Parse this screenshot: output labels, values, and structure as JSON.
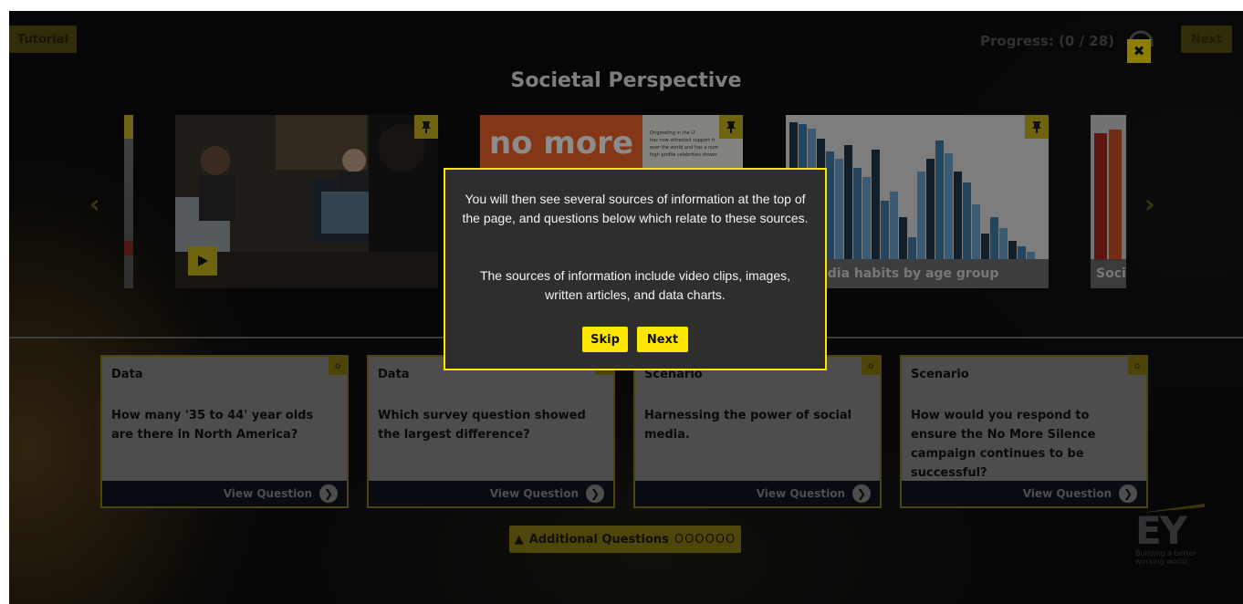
{
  "header": {
    "tutorial_label": "Tutorial",
    "progress_text": "Progress: (0 / 28)",
    "next_label": "Next",
    "close_label": "✖"
  },
  "page_title": "Societal Perspective",
  "sources": {
    "cards": [
      {
        "kind": "video",
        "caption": ""
      },
      {
        "kind": "article",
        "headline": "no more",
        "caption": ""
      },
      {
        "kind": "chart",
        "caption": "l media habits by age group"
      },
      {
        "kind": "partial",
        "caption": "Soci"
      }
    ],
    "article_snippet": [
      "Originating in the U",
      "has now attracted support fr",
      "over the world and has a num",
      "high profile celebrities shown"
    ]
  },
  "modal": {
    "paragraph1": "You will then see several sources of information at the top of the page, and questions below which relate to these sources.",
    "paragraph2": "The sources of information include video clips, images, written articles, and data charts.",
    "skip_label": "Skip",
    "next_label": "Next"
  },
  "questions": [
    {
      "type": "Data",
      "text": "How many '35 to 44' year olds are there in North America?",
      "action": "View Question",
      "badge": "o"
    },
    {
      "type": "Data",
      "text": "Which survey question showed the largest difference?",
      "action": "View Question",
      "badge": "o"
    },
    {
      "type": "Scenario",
      "text": "Harnessing the power of social media.",
      "action": "View Question",
      "badge": "o"
    },
    {
      "type": "Scenario",
      "text": "How would you respond to ensure the No More Silence campaign continues to be successful?",
      "action": "View Question",
      "badge": "o"
    }
  ],
  "additional": {
    "label": "Additional Questions",
    "dots": "OOOOOO"
  },
  "brand": {
    "logo": "EY",
    "tagline_line1": "Building a better",
    "tagline_line2": "working world"
  },
  "colors": {
    "accent": "#ffe600",
    "modal_bg": "#2e2e2e"
  }
}
